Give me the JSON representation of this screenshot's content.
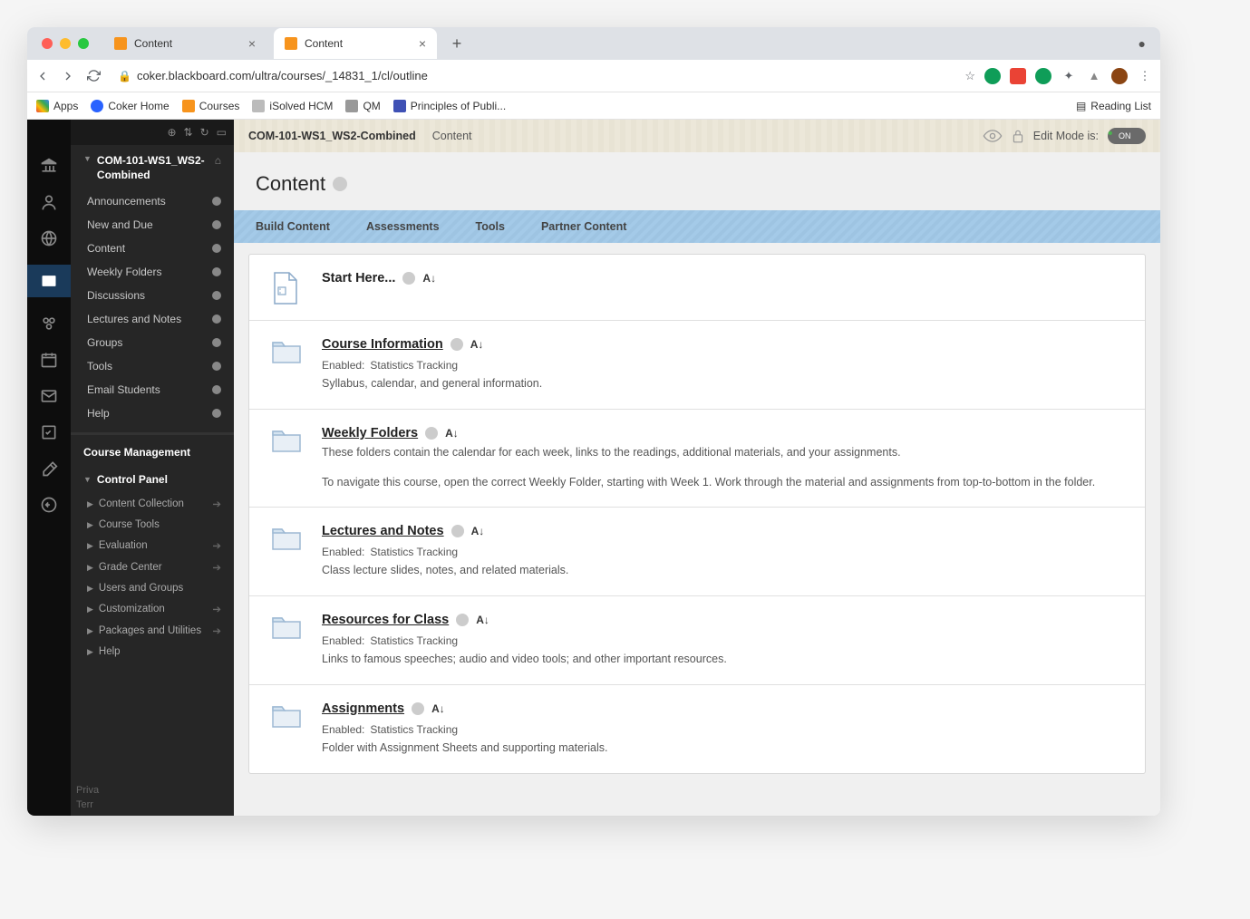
{
  "browser": {
    "tabs": [
      {
        "title": "Content",
        "active": false
      },
      {
        "title": "Content",
        "active": true
      }
    ],
    "url": "coker.blackboard.com/ultra/courses/_14831_1/cl/outline",
    "bookmarks": [
      "Apps",
      "Coker Home",
      "Courses",
      "iSolved HCM",
      "QM",
      "Principles of Publi..."
    ],
    "reading_list": "Reading List"
  },
  "topbar": {
    "breadcrumb1": "COM-101-WS1_WS2-Combined",
    "breadcrumb2": "Content",
    "edit_mode_label": "Edit Mode is:",
    "edit_mode_value": "ON"
  },
  "sidebar": {
    "course_name": "COM-101-WS1_WS2-Combined",
    "items": [
      "Announcements",
      "New and Due",
      "Content",
      "Weekly Folders",
      "Discussions",
      "Lectures and Notes",
      "Groups",
      "Tools",
      "Email Students",
      "Help"
    ],
    "mgmt_header": "Course Management",
    "cp_header": "Control Panel",
    "cp_items": [
      "Content Collection",
      "Course Tools",
      "Evaluation",
      "Grade Center",
      "Users and Groups",
      "Customization",
      "Packages and Utilities",
      "Help"
    ]
  },
  "page": {
    "title": "Content",
    "action_bar": [
      "Build Content",
      "Assessments",
      "Tools",
      "Partner Content"
    ]
  },
  "items": [
    {
      "type": "file",
      "title": "Start Here...",
      "link": false,
      "enabled": "",
      "desc": ""
    },
    {
      "type": "folder",
      "title": "Course Information",
      "link": true,
      "enabled_lbl": "Enabled:",
      "enabled_val": "Statistics Tracking",
      "desc": "Syllabus, calendar, and general information."
    },
    {
      "type": "folder",
      "title": "Weekly Folders",
      "link": true,
      "enabled_lbl": "",
      "enabled_val": "",
      "desc": "These folders contain the calendar for each week, links to the readings, additional materials, and your assignments.",
      "desc2": "To navigate this course, open the correct Weekly Folder, starting with Week 1. Work through the material and assignments from top-to-bottom in the folder."
    },
    {
      "type": "folder",
      "title": "Lectures and Notes",
      "link": true,
      "enabled_lbl": "Enabled:",
      "enabled_val": "Statistics Tracking",
      "desc": "Class lecture slides, notes, and related materials."
    },
    {
      "type": "folder",
      "title": "Resources for Class",
      "link": true,
      "enabled_lbl": "Enabled:",
      "enabled_val": "Statistics Tracking",
      "desc": "Links to famous speeches; audio and video tools; and other important resources."
    },
    {
      "type": "folder",
      "title": "Assignments",
      "link": true,
      "enabled_lbl": "Enabled:",
      "enabled_val": "Statistics Tracking",
      "desc": "Folder with Assignment Sheets and supporting materials."
    }
  ],
  "footer": {
    "l1": "Priva",
    "l2": "Terr"
  }
}
